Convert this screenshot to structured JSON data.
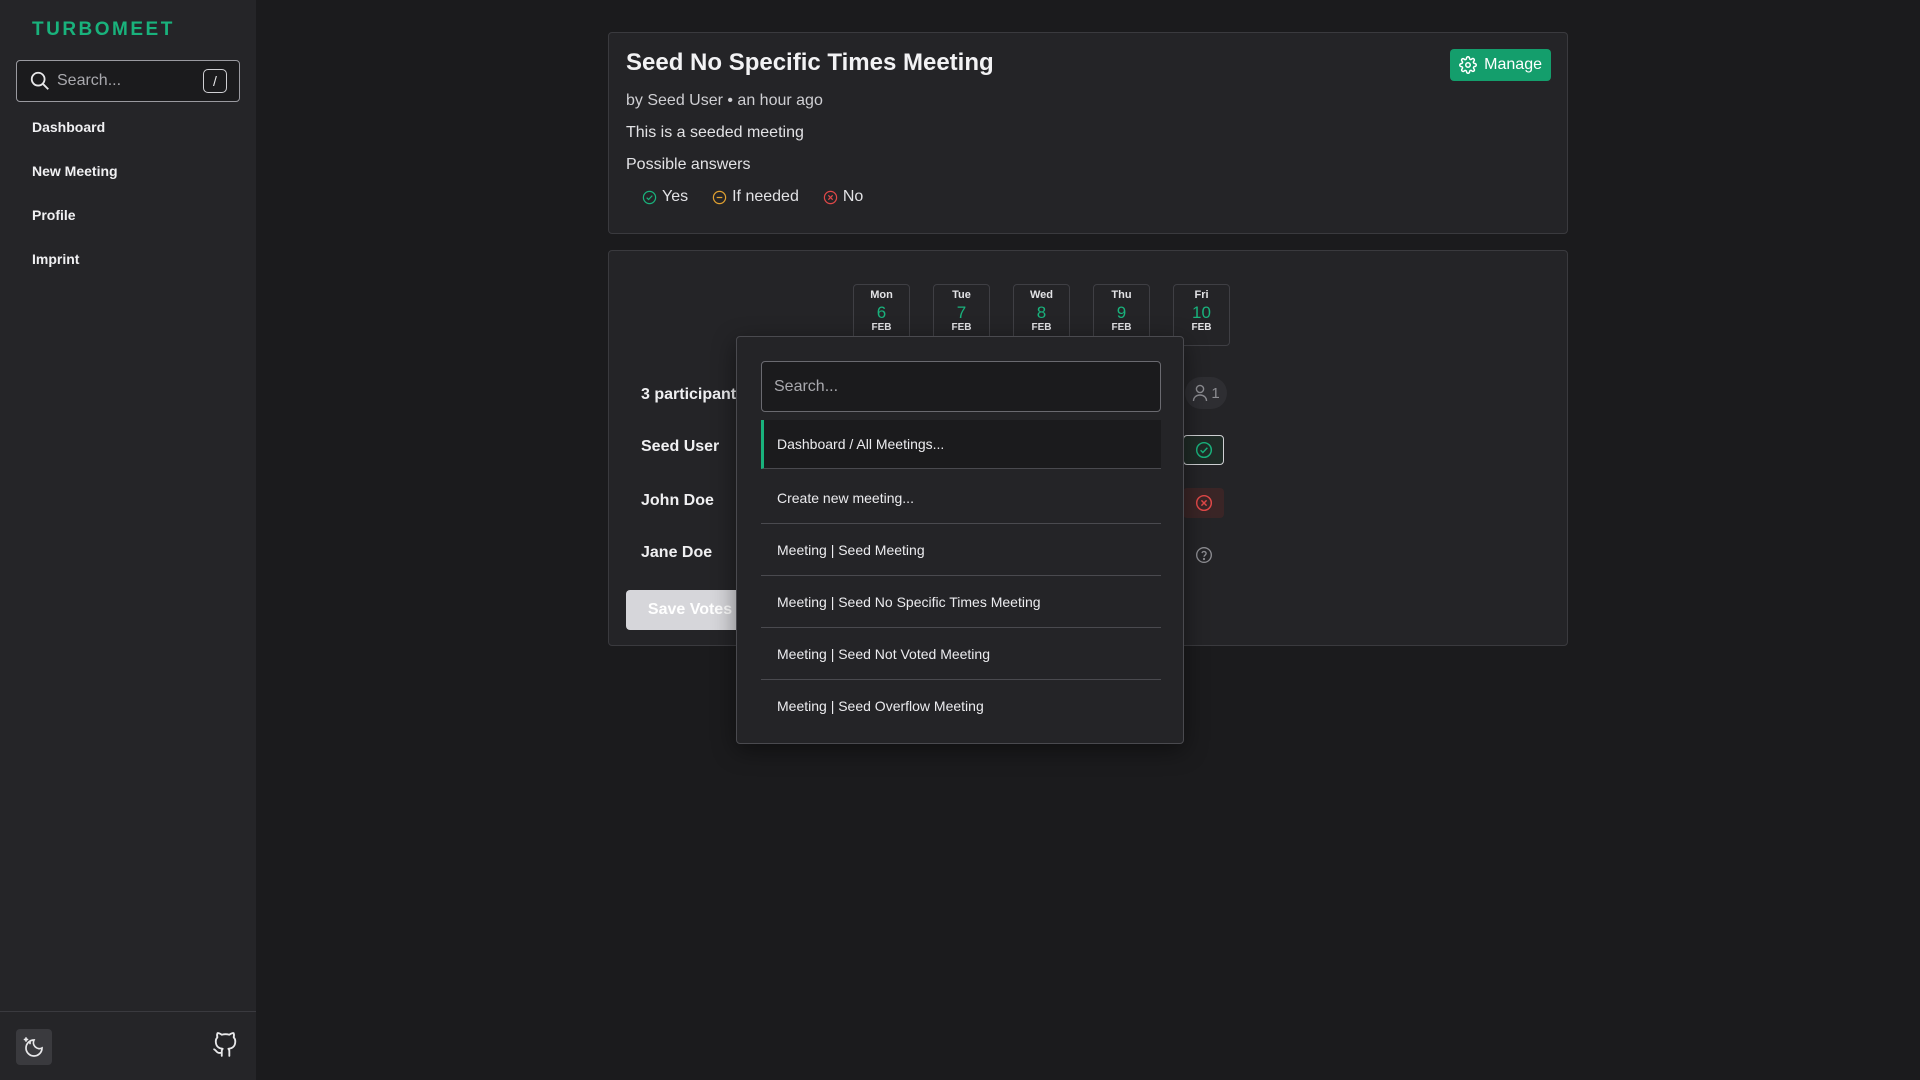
{
  "sidebar": {
    "brand": "TURBOMEET",
    "search_placeholder": "Search...",
    "search_shortcut": "/",
    "nav": [
      {
        "label": "Dashboard"
      },
      {
        "label": "New Meeting"
      },
      {
        "label": "Profile"
      },
      {
        "label": "Imprint"
      }
    ]
  },
  "meeting": {
    "title": "Seed No Specific Times Meeting",
    "manage_label": "Manage",
    "meta": "by Seed User • an hour ago",
    "description": "This is a seeded meeting",
    "possible_answers_label": "Possible answers",
    "answers": [
      {
        "label": "Yes",
        "color": "#19b27c"
      },
      {
        "label": "If needed",
        "color": "#e0a030"
      },
      {
        "label": "No",
        "color": "#e04848"
      }
    ]
  },
  "poll": {
    "dates": [
      {
        "dow": "Mon",
        "day": "6",
        "month": "FEB"
      },
      {
        "dow": "Tue",
        "day": "7",
        "month": "FEB"
      },
      {
        "dow": "Wed",
        "day": "8",
        "month": "FEB"
      },
      {
        "dow": "Thu",
        "day": "9",
        "month": "FEB"
      },
      {
        "dow": "Fri",
        "day": "10",
        "month": "FEB"
      }
    ],
    "participants_label": "3 participants",
    "participants": [
      "Seed User",
      "John Doe",
      "Jane Doe"
    ],
    "yes_count": "1",
    "save_label": "Save Votes"
  },
  "palette": {
    "search_placeholder": "Search...",
    "items": [
      {
        "label": "Dashboard / All Meetings..."
      },
      {
        "label": "Create new meeting..."
      },
      {
        "label": "Meeting | Seed Meeting"
      },
      {
        "label": "Meeting | Seed No Specific Times Meeting"
      },
      {
        "label": "Meeting | Seed Not Voted Meeting"
      },
      {
        "label": "Meeting | Seed Overflow Meeting"
      }
    ]
  },
  "colors": {
    "accent": "#19b27c",
    "background": "#1b1b1d",
    "sidebar": "#252528",
    "card": "#242427"
  },
  "icons": {
    "sidebar_search": "search-icon",
    "theme": "moon-sun-icon",
    "github": "github-icon",
    "manage": "gear-icon",
    "participant": "user-icon"
  }
}
